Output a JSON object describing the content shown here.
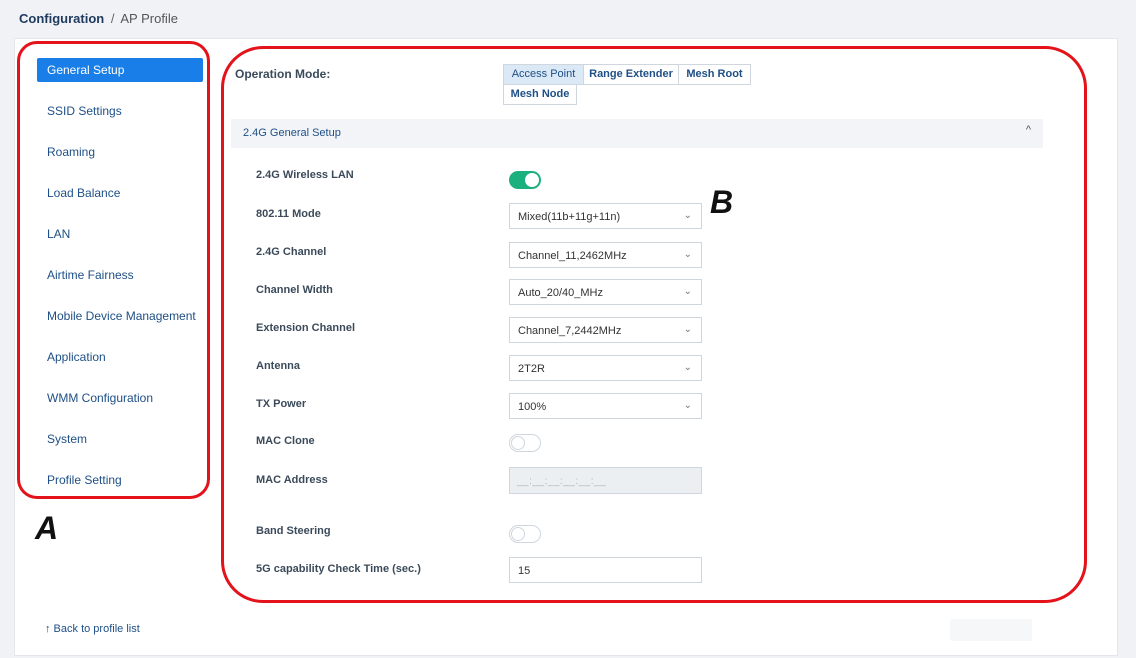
{
  "breadcrumb": {
    "root": "Configuration",
    "separator": "/",
    "current": "AP Profile"
  },
  "sidebar": {
    "items": [
      {
        "label": "General Setup",
        "active": true
      },
      {
        "label": "SSID Settings"
      },
      {
        "label": "Roaming"
      },
      {
        "label": "Load Balance"
      },
      {
        "label": "LAN"
      },
      {
        "label": "Airtime Fairness"
      },
      {
        "label": "Mobile Device Management"
      },
      {
        "label": "Application"
      },
      {
        "label": "WMM Configuration"
      },
      {
        "label": "System"
      },
      {
        "label": "Profile Setting"
      }
    ],
    "back_link": "↑ Back to profile list"
  },
  "operation_mode": {
    "label": "Operation Mode:",
    "options": [
      "Access Point",
      "Range Extender",
      "Mesh Root",
      "Mesh Node"
    ],
    "selected": "Access Point"
  },
  "section": {
    "title": "2.4G General Setup",
    "chevron": "^"
  },
  "fields": {
    "wireless_lan": {
      "label": "2.4G Wireless LAN",
      "enabled": true
    },
    "mode_80211": {
      "label": "802.11 Mode",
      "value": "Mixed(11b+11g+11n)"
    },
    "channel": {
      "label": "2.4G Channel",
      "value": "Channel_11,2462MHz"
    },
    "channel_width": {
      "label": "Channel Width",
      "value": "Auto_20/40_MHz"
    },
    "extension_channel": {
      "label": "Extension Channel",
      "value": "Channel_7,2442MHz"
    },
    "antenna": {
      "label": "Antenna",
      "value": "2T2R"
    },
    "tx_power": {
      "label": "TX Power",
      "value": "100%"
    },
    "mac_clone": {
      "label": "MAC Clone",
      "enabled": false
    },
    "mac_address": {
      "label": "MAC Address",
      "placeholder": "__:__:__:__:__:__"
    },
    "band_steering": {
      "label": "Band Steering",
      "enabled": false
    },
    "capability_check": {
      "label": "5G capability Check Time (sec.)",
      "value": "15"
    }
  },
  "annotations": {
    "a": "A",
    "b": "B",
    "color": "#e3121b"
  },
  "colors": {
    "accent": "#1a7ee8",
    "toggle_on": "#1bb07e",
    "link": "#1e4f86"
  }
}
